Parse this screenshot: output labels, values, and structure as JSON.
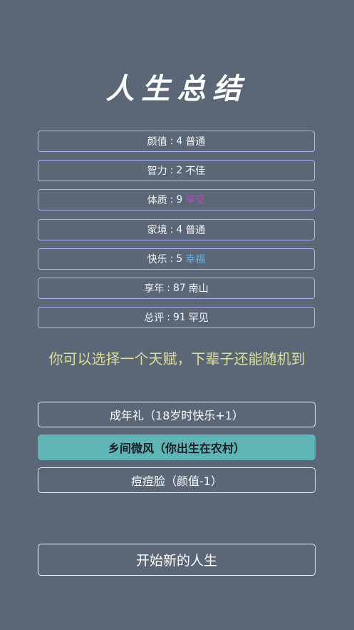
{
  "title": "人生总结",
  "stats": [
    {
      "label": "颜值",
      "value": "4",
      "grade": "普通",
      "grade_color": "#f4f4f4"
    },
    {
      "label": "智力",
      "value": "2",
      "grade": "不佳",
      "grade_color": "#f4f4f4"
    },
    {
      "label": "体质",
      "value": "9",
      "grade": "罕见",
      "grade_color": "#c042c8"
    },
    {
      "label": "家境",
      "value": "4",
      "grade": "普通",
      "grade_color": "#f4f4f4"
    },
    {
      "label": "快乐",
      "value": "5",
      "grade": "幸福",
      "grade_color": "#5fb0e6"
    },
    {
      "label": "享年",
      "value": "87",
      "grade": "南山",
      "grade_color": "#f4f4f4"
    },
    {
      "label": "总评",
      "value": "91",
      "grade": "罕见",
      "grade_color": "#f4f4f4"
    }
  ],
  "separator": ":",
  "hint": "你可以选择一个天赋，下辈子还能随机到",
  "talents": [
    {
      "label": "成年礼（18岁时快乐+1）",
      "selected": false
    },
    {
      "label": "乡间微风（你出生在农村）",
      "selected": true
    },
    {
      "label": "痘痘脸（颜值-1）",
      "selected": false
    }
  ],
  "restart_label": "开始新的人生",
  "colors": {
    "background": "#5b6677",
    "stat_border": "#a9b4f0",
    "hint": "#dedd99",
    "selected_talent": "#5fb4b6"
  }
}
